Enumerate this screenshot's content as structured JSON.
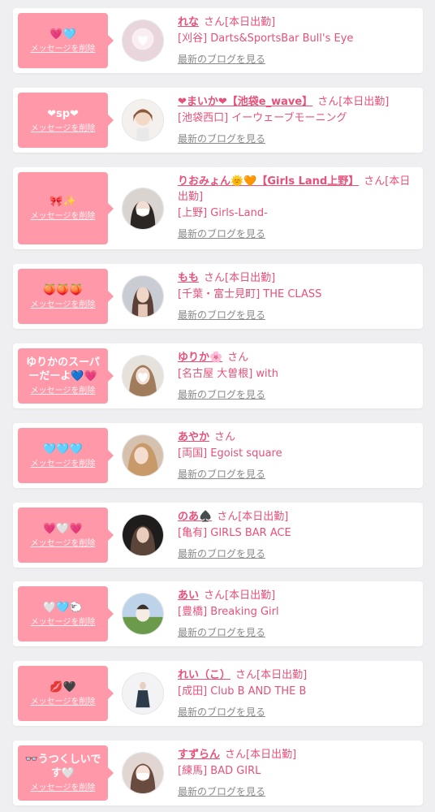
{
  "delete_label": "メッセージを削除",
  "blog_label": "最新のブログを見る",
  "colors": {
    "background": "#efeff1",
    "bubble": "#ff99aa",
    "accent": "#e8507a",
    "link_gray": "#8a8a8a"
  },
  "cards": [
    {
      "message": "💗🩵",
      "name": "れな",
      "suffix": "さん[本日出勤]",
      "shop": "[刈谷] Darts&SportsBar Bull's Eye",
      "avatar_icon": "avatar-photo-icon"
    },
    {
      "message": "❤sp❤",
      "name": "❤まいか❤【池袋e_wave】",
      "suffix": "さん[本日出勤]",
      "shop": "[池袋西口] イーウェーブモーニング",
      "avatar_icon": "avatar-photo-icon"
    },
    {
      "message": "🎀✨",
      "name": "りおみょん🌞🧡【Girls Land上野】",
      "suffix": "さん[本日出勤]",
      "shop": "[上野] Girls-Land-",
      "avatar_icon": "avatar-photo-icon"
    },
    {
      "message": "🍑🍑🍑",
      "name": "もも",
      "suffix": "さん[本日出勤]",
      "shop": "[千葉・富士見町] THE CLASS",
      "avatar_icon": "avatar-photo-icon"
    },
    {
      "message": "ゆりかのスーパーだーよ💙💗",
      "name": "ゆりか🌸",
      "suffix": "さん",
      "shop": "[名古屋 大曽根] with",
      "avatar_icon": "avatar-photo-icon"
    },
    {
      "message": "🩵🩵🩵",
      "name": "あやか",
      "suffix": "さん",
      "shop": "[両国] Egoist square",
      "avatar_icon": "avatar-photo-icon"
    },
    {
      "message": "💗🤍💗",
      "name": "のあ♠️",
      "suffix": "さん[本日出勤]",
      "shop": "[亀有] GIRLS BAR ACE",
      "avatar_icon": "avatar-photo-icon"
    },
    {
      "message": "🤍🩵🐑",
      "name": "あい",
      "suffix": "さん[本日出勤]",
      "shop": "[豊橋] Breaking Girl",
      "avatar_icon": "avatar-photo-icon"
    },
    {
      "message": "💋🖤",
      "name": "れい（こ）",
      "suffix": "さん[本日出勤]",
      "shop": "[成田] Club B AND THE B",
      "avatar_icon": "avatar-photo-icon"
    },
    {
      "message": "👓うつくしいです🤍",
      "name": "すずらん",
      "suffix": "さん[本日出勤]",
      "shop": "[練馬] BAD GIRL",
      "avatar_icon": "avatar-photo-icon"
    }
  ]
}
